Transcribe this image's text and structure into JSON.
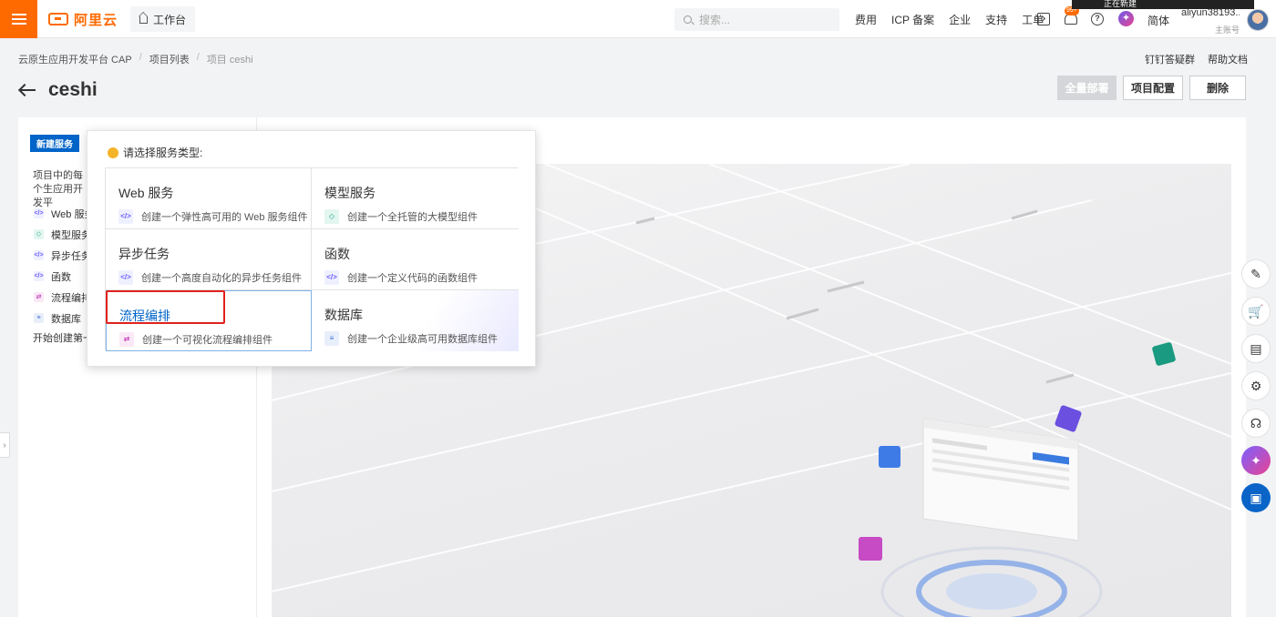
{
  "brand": "阿里云",
  "topbar": {
    "workbench": "工作台",
    "search_placeholder": "搜索...",
    "links": [
      "费用",
      "ICP 备案",
      "企业",
      "支持",
      "工单"
    ],
    "badge": "99+",
    "lang": "简体",
    "tooltip": "正在新建",
    "user_name": "aliyun38193...",
    "user_role": "主账号"
  },
  "breadcrumb": [
    "云原生应用开发平台 CAP",
    "项目列表",
    "项目 ceshi"
  ],
  "help_links": [
    "钉钉答疑群",
    "帮助文档"
  ],
  "page_title": "ceshi",
  "actions": {
    "deploy": "全量部署",
    "config": "项目配置",
    "delete": "删除"
  },
  "left": {
    "new_service": "新建服务",
    "description": "项目中的每个生应用开发平",
    "services": [
      {
        "label": "Web 服务",
        "icon": "code-icon"
      },
      {
        "label": "模型服务",
        "icon": "cube-icon"
      },
      {
        "label": "异步任务",
        "icon": "code-icon"
      },
      {
        "label": "函数",
        "icon": "code-icon"
      },
      {
        "label": "流程编排",
        "icon": "flow-icon"
      },
      {
        "label": "数据库",
        "icon": "database-icon"
      }
    ],
    "start_create": "开始创建第一"
  },
  "dropdown": {
    "heading": "请选择服务类型:",
    "cards": [
      {
        "title": "Web 服务",
        "desc": "创建一个弹性高可用的 Web 服务组件",
        "icon": "code-icon"
      },
      {
        "title": "模型服务",
        "desc": "创建一个全托管的大模型组件",
        "icon": "cube-icon"
      },
      {
        "title": "异步任务",
        "desc": "创建一个高度自动化的异步任务组件",
        "icon": "code-icon"
      },
      {
        "title": "函数",
        "desc": "创建一个定义代码的函数组件",
        "icon": "code-icon"
      },
      {
        "title": "流程编排",
        "desc": "创建一个可视化流程编排组件",
        "icon": "flow-icon"
      },
      {
        "title": "数据库",
        "desc": "创建一个企业级高可用数据库组件",
        "icon": "database-icon"
      }
    ]
  },
  "colors": {
    "brand": "#ff6a00",
    "primary": "#0064c8",
    "highlight": "#e0211c"
  }
}
